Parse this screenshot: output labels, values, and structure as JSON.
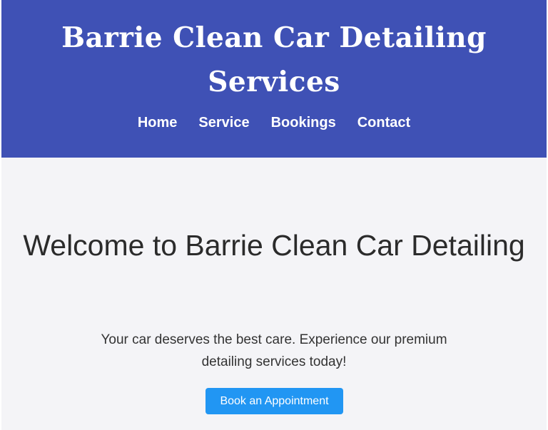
{
  "header": {
    "site_title": "Barrie Clean Car Detailing Services",
    "nav": [
      {
        "label": "Home"
      },
      {
        "label": "Service"
      },
      {
        "label": "Bookings"
      },
      {
        "label": "Contact"
      }
    ]
  },
  "hero": {
    "heading": "Welcome to Barrie Clean Car Detailing",
    "text": "Your car deserves the best care. Experience our premium detailing services today!",
    "cta_label": "Book an Appointment"
  },
  "colors": {
    "header_bg": "#3f51b5",
    "hero_bg": "#f4f4f7",
    "button_bg": "#2196f3",
    "text_dark": "#2b2b2b",
    "text_light": "#ffffff"
  }
}
